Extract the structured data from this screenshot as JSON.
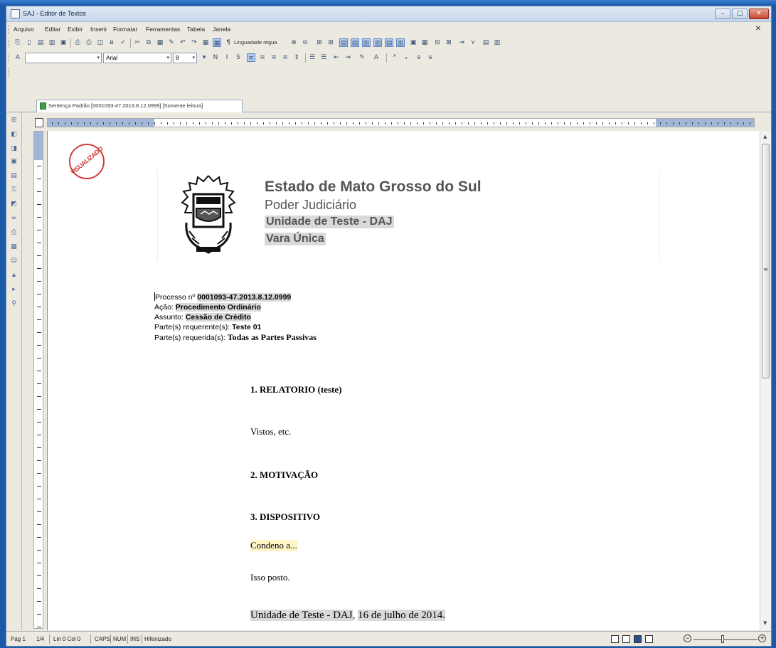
{
  "window": {
    "title": "SAJ - Editor de Textos",
    "min": "–",
    "max": "□",
    "close": "✕"
  },
  "menu": {
    "items": [
      "Arquivo",
      "Editar",
      "Exibir",
      "Inserir",
      "Formatar",
      "Ferramentas",
      "Tabela",
      "Janela"
    ],
    "close_doc": "✕"
  },
  "toolbar1": {
    "guide_label": "Linguadade régua"
  },
  "toolbar2": {
    "style_value": "",
    "font_value": "Arial",
    "size_value": "8"
  },
  "tab": {
    "label": "Sentença Padrão [0001093-47.2013.8.12.0999] [Somente leitura]"
  },
  "document": {
    "stamp": "VISUALIZADO",
    "header": {
      "line1": "Estado de Mato Grosso do Sul",
      "line2": "Poder Judiciário",
      "line3": "Unidade de Teste - DAJ",
      "line4": "Vara Única"
    },
    "meta": {
      "processo_label": "Processo nº",
      "processo_value": "0001093-47.2013.8.12.0999",
      "acao_label": "Ação:",
      "acao_value": "Procedimento Ordinário",
      "assunto_label": "Assunto:",
      "assunto_value": "Cessão de Crédito",
      "requerente_label": "Parte(s) requerente(s):",
      "requerente_value": "Teste 01",
      "requerida_label": "Parte(s) requerida(s):",
      "requerida_value": "Todas as Partes Passivas"
    },
    "section1": "1. RELATORIO (teste)",
    "vistos": "Vistos, etc.",
    "section2": "2. MOTIVAÇÃO",
    "section3": "3. DISPOSITIVO",
    "condeno": "Condeno a...",
    "isso": "Isso posto.",
    "local": "Unidade de Teste - DAJ",
    "date_sep": ", ",
    "date": "16 de julho de 2014."
  },
  "status": {
    "page": "Pág 1",
    "pages": "1/4",
    "linecol": "Lin 0 Col 0",
    "caps": "CAPS",
    "num": "NUM",
    "ins": "INS",
    "hifen": "Hifenizado"
  }
}
